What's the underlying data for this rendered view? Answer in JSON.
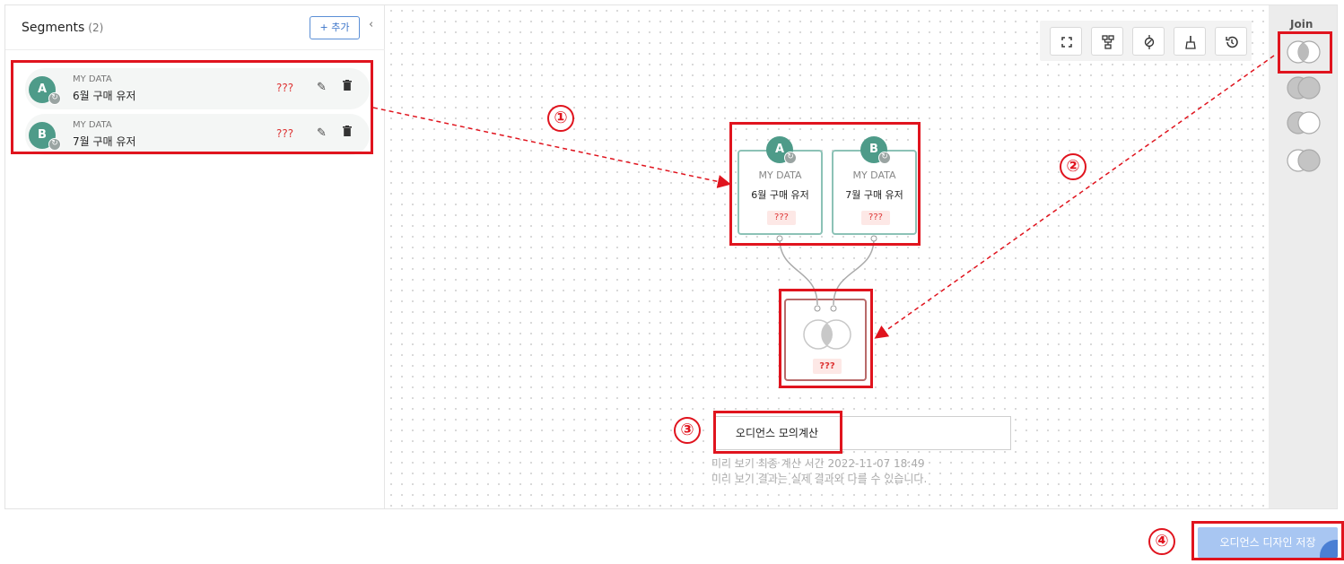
{
  "segments_panel": {
    "title": "Segments",
    "count": "(2)",
    "add_label": "+ 추가",
    "collapse_glyph": "‹",
    "items": [
      {
        "letter": "A",
        "source": "MY DATA",
        "name": "6월 구매 유저",
        "count": "???"
      },
      {
        "letter": "B",
        "source": "MY DATA",
        "name": "7월 구매 유저",
        "count": "???"
      }
    ]
  },
  "toolbar": {
    "icons": [
      "fit-screen-icon",
      "auto-layout-icon",
      "center-node-icon",
      "clean-icon",
      "history-icon"
    ]
  },
  "canvas": {
    "nodes": [
      {
        "letter": "A",
        "source": "MY DATA",
        "name": "6월 구매 유저",
        "count": "???"
      },
      {
        "letter": "B",
        "source": "MY DATA",
        "name": "7월 구매 유저",
        "count": "???"
      }
    ],
    "join_node": {
      "type": "intersection",
      "count": "???"
    },
    "calc_button": "오디언스 모의계산",
    "note_line1": "미리 보기 최종 계산 시간 2022-11-07 18:49",
    "note_line2": "미리 보기 결과는 실제 결과와 다를 수 있습니다."
  },
  "join_panel": {
    "title": "Join",
    "options": [
      "intersection",
      "union",
      "left-only",
      "right-only"
    ]
  },
  "save_button": "오디언스 디자인 저장",
  "annotations": {
    "markers": [
      "①",
      "②",
      "③",
      "④"
    ],
    "color": "#e0141e"
  },
  "colors": {
    "segment_avatar": "#4e9b89",
    "node_border": "#8cc2b6",
    "join_node_border": "#b86a6a",
    "count_text": "#dd3333",
    "save_button_bg": "#a8c6f2"
  }
}
